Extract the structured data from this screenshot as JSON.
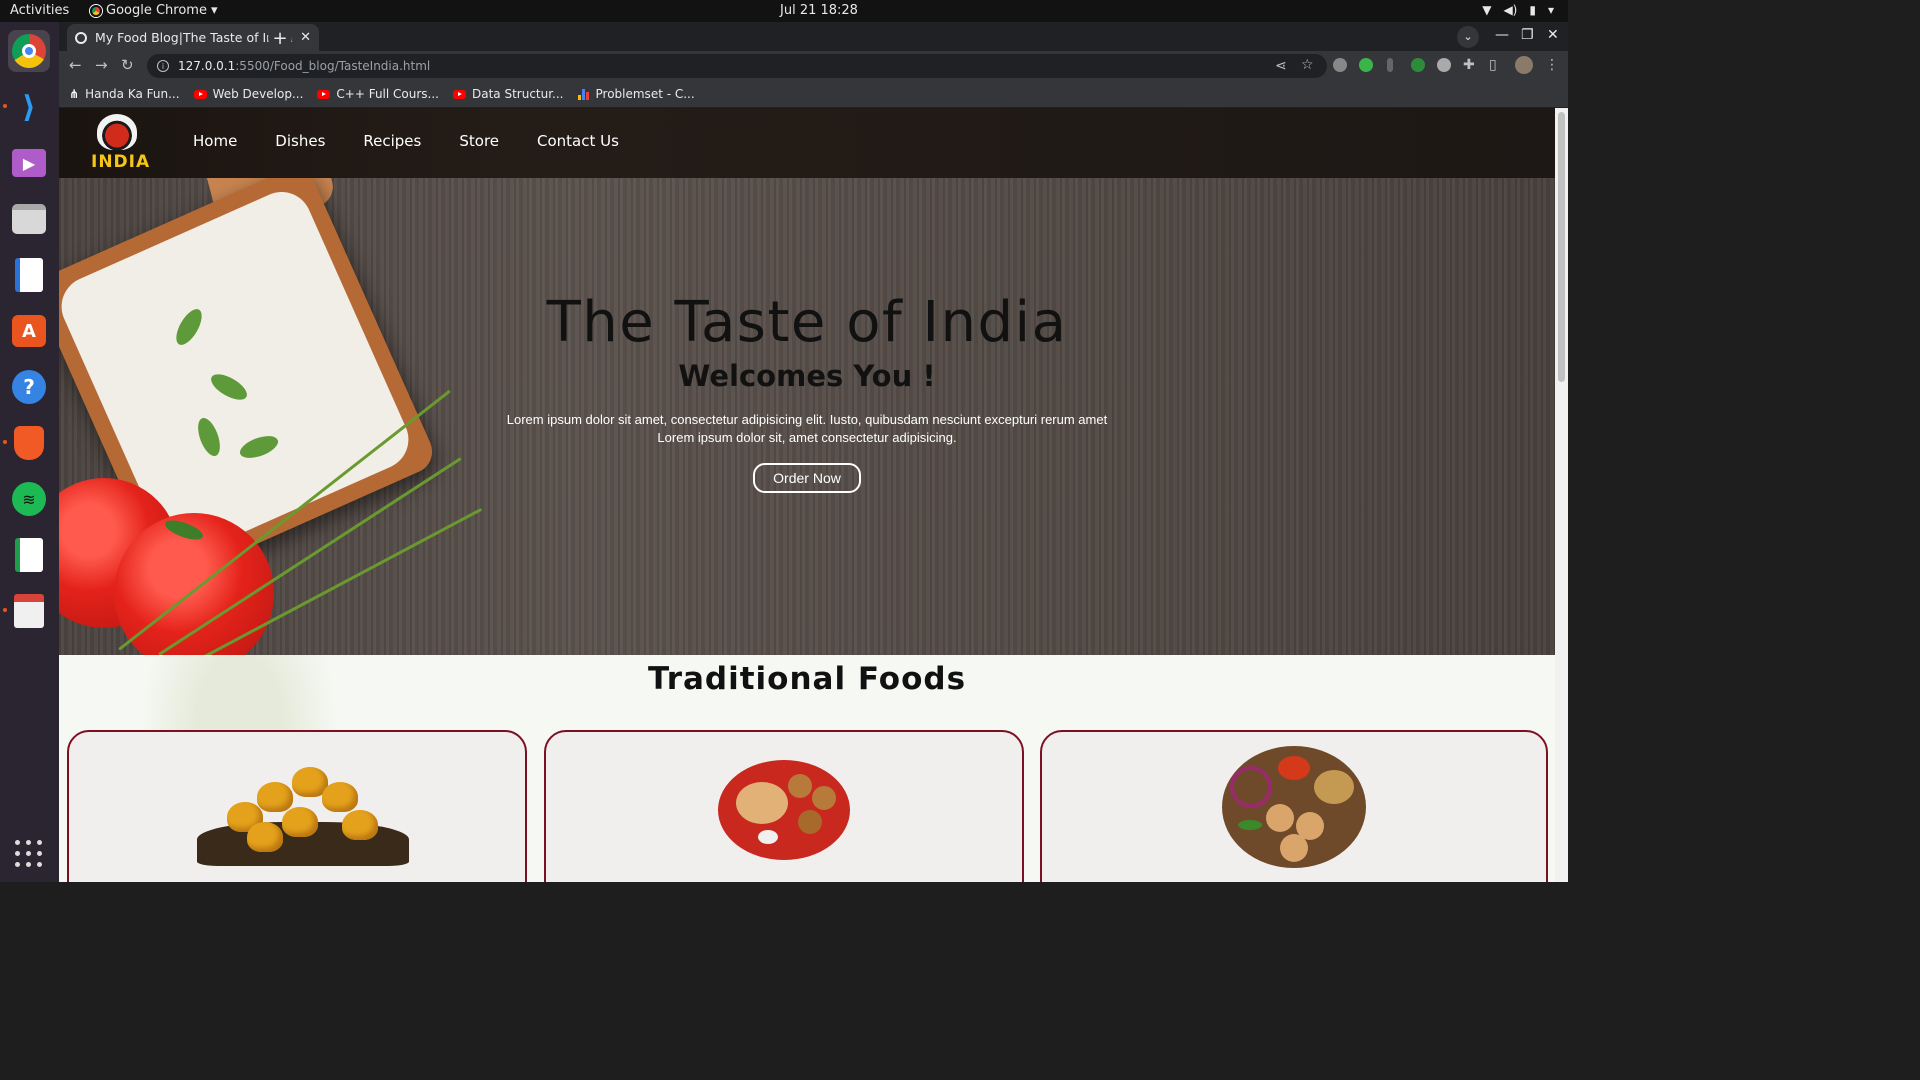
{
  "system": {
    "activities": "Activities",
    "app_name": "Google Chrome",
    "clock": "Jul 21  18:28"
  },
  "browser": {
    "tab_title": "My Food Blog|The Taste of India",
    "url_host": "127.0.0.1",
    "url_path": ":5500/Food_blog/TasteIndia.html",
    "bookmarks": [
      {
        "label": "Handa Ka Fun...",
        "icon": "m-logo-icon"
      },
      {
        "label": "Web Develop...",
        "icon": "youtube-icon"
      },
      {
        "label": "C++ Full Cours...",
        "icon": "youtube-icon"
      },
      {
        "label": "Data Structur...",
        "icon": "youtube-icon"
      },
      {
        "label": "Problemset - C...",
        "icon": "bar-chart-icon"
      }
    ]
  },
  "site": {
    "logo_text": "INDIA",
    "nav": [
      "Home",
      "Dishes",
      "Recipes",
      "Store",
      "Contact Us"
    ],
    "hero": {
      "title": "The Taste of India",
      "subtitle": "Welcomes You !",
      "text_line1": "Lorem ipsum dolor sit amet, consectetur adipisicing elit. Iusto, quibusdam nesciunt excepturi rerum amet",
      "text_line2": "Lorem ipsum dolor sit, amet consectetur adipisicing.",
      "cta": "Order Now"
    },
    "section_title": "Traditional Foods",
    "colors": {
      "card_border": "#7a1022",
      "logo_accent": "#f5c518"
    }
  }
}
